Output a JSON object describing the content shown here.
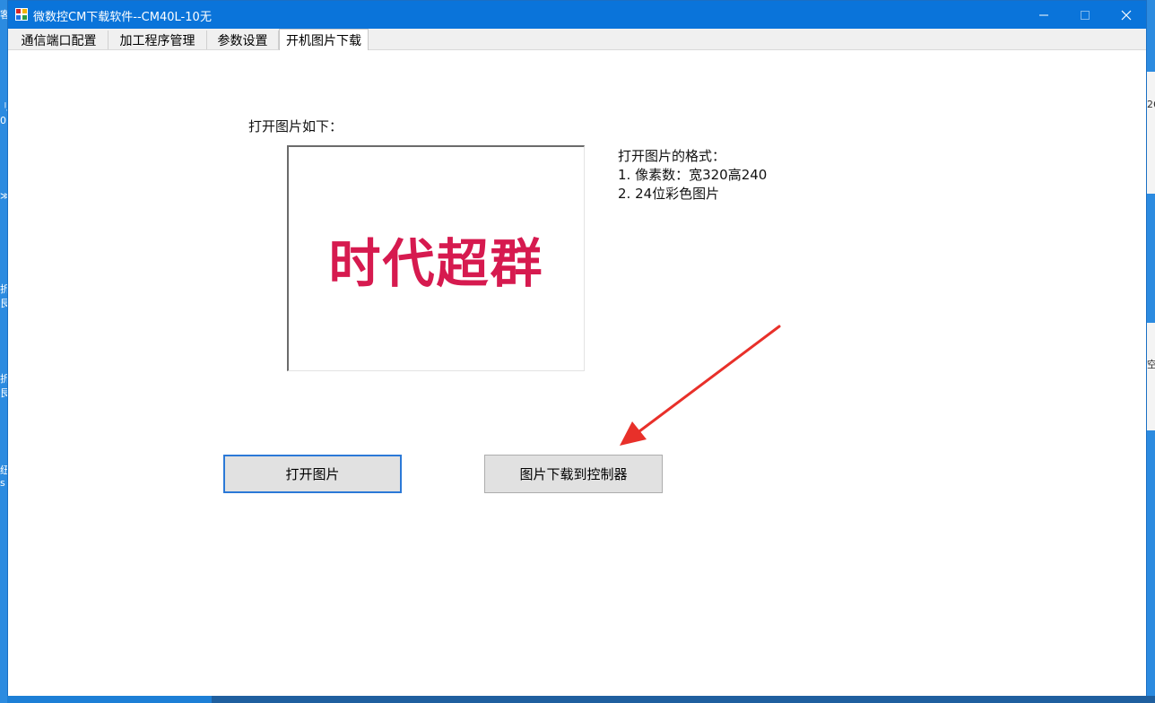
{
  "desktop": {
    "left_fragments": [
      "客",
      "刂",
      "0",
      "≫",
      "折",
      "艮",
      "折",
      "艮",
      "纽",
      "s"
    ],
    "right_fragments": [
      "26",
      "空"
    ]
  },
  "window": {
    "title": "微数控CM下载软件--CM40L-10",
    "status": "无",
    "controls": {
      "minimize": "—",
      "maximize": "□",
      "close": "✕"
    }
  },
  "tabs": [
    {
      "label": "通信端口配置"
    },
    {
      "label": "加工程序管理"
    },
    {
      "label": "参数设置"
    },
    {
      "label": "开机图片下载"
    }
  ],
  "active_tab": "开机图片下载",
  "main": {
    "open_image_label": "打开图片如下：",
    "preview_text": "时代超群",
    "format": {
      "title": "打开图片的格式：",
      "line1": "1. 像素数：宽320高240",
      "line2": "2. 24位彩色图片"
    },
    "open_button": "打开图片",
    "download_button": "图片下载到控制器"
  },
  "colors": {
    "title_bar": "#0a74da",
    "preview_text": "#d61a4f",
    "arrow": "#e8302a",
    "focus_border": "#2b79d7"
  }
}
